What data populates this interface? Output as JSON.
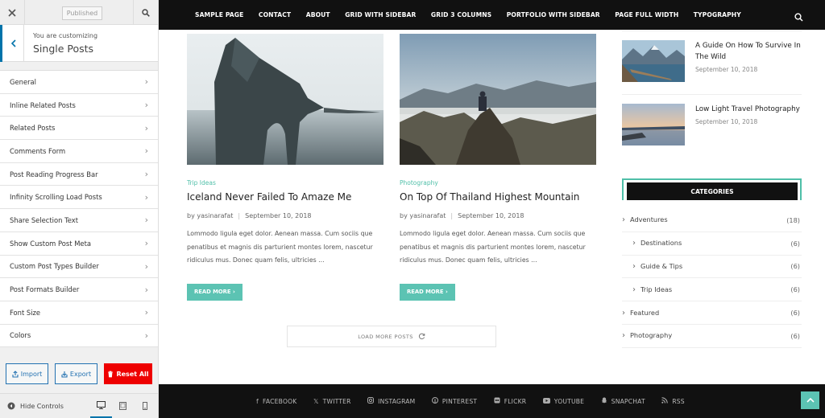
{
  "customizer": {
    "published_label": "Published",
    "subtitle": "You are customizing",
    "title": "Single Posts",
    "items": [
      {
        "label": "General"
      },
      {
        "label": "Inline Related Posts"
      },
      {
        "label": "Related Posts"
      },
      {
        "label": "Comments Form"
      },
      {
        "label": "Post Reading Progress Bar"
      },
      {
        "label": "Infinity Scrolling Load Posts"
      },
      {
        "label": "Share Selection Text"
      },
      {
        "label": "Show Custom Post Meta"
      },
      {
        "label": "Custom Post Types Builder"
      },
      {
        "label": "Post Formats Builder"
      },
      {
        "label": "Font Size"
      },
      {
        "label": "Colors"
      }
    ],
    "import_label": "Import",
    "export_label": "Export",
    "reset_label": "Reset All",
    "hide_controls_label": "Hide Controls",
    "colors": {
      "accent": "#0073aa",
      "reset": "#ee0000"
    }
  },
  "nav": {
    "items": [
      "SAMPLE PAGE",
      "CONTACT",
      "ABOUT",
      "GRID WITH SIDEBAR",
      "GRID 3 COLUMNS",
      "PORTFOLIO WITH SIDEBAR",
      "PAGE FULL WIDTH",
      "TYPOGRAPHY"
    ]
  },
  "posts": [
    {
      "category": "Trip Ideas",
      "title": "Iceland Never Failed To Amaze Me",
      "author": "by yasinarafat",
      "date": "September 10, 2018",
      "excerpt": "Lommodo ligula eget dolor. Aenean massa. Cum sociis que penatibus et magnis dis parturient montes lorem, nascetur ridiculus mus. Donec quam felis, ultricies ...",
      "read_more": "READ MORE"
    },
    {
      "category": "Photography",
      "title": "On Top Of Thailand Highest Mountain",
      "author": "by yasinarafat",
      "date": "September 10, 2018",
      "excerpt": "Lommodo ligula eget dolor. Aenean massa. Cum sociis que penatibus et magnis dis parturient montes lorem, nascetur ridiculus mus. Donec quam felis, ultricies ...",
      "read_more": "READ MORE"
    }
  ],
  "load_more_label": "LOAD MORE POSTS",
  "recent_posts": [
    {
      "title": "A Guide On How To Survive In The Wild",
      "date": "September 10, 2018"
    },
    {
      "title": "Low Light Travel Photography",
      "date": "September 10, 2018"
    }
  ],
  "categories_widget": {
    "title": "CATEGORIES",
    "rows": [
      {
        "label": "Adventures",
        "count": "(18)",
        "child": false
      },
      {
        "label": "Destinations",
        "count": "(6)",
        "child": true
      },
      {
        "label": "Guide & Tips",
        "count": "(6)",
        "child": true
      },
      {
        "label": "Trip Ideas",
        "count": "(6)",
        "child": true
      },
      {
        "label": "Featured",
        "count": "(6)",
        "child": false
      },
      {
        "label": "Photography",
        "count": "(6)",
        "child": false
      }
    ]
  },
  "footer": {
    "social": [
      {
        "label": "FACEBOOK",
        "icon": "facebook-icon"
      },
      {
        "label": "TWITTER",
        "icon": "x-twitter-icon"
      },
      {
        "label": "INSTAGRAM",
        "icon": "instagram-icon"
      },
      {
        "label": "PINTEREST",
        "icon": "pinterest-icon"
      },
      {
        "label": "FLICKR",
        "icon": "flickr-icon"
      },
      {
        "label": "YOUTUBE",
        "icon": "youtube-icon"
      },
      {
        "label": "SNAPCHAT",
        "icon": "snapchat-icon"
      },
      {
        "label": "RSS",
        "icon": "rss-icon"
      }
    ]
  },
  "theme": {
    "accent": "#5cc3b3",
    "dark": "#111111"
  }
}
